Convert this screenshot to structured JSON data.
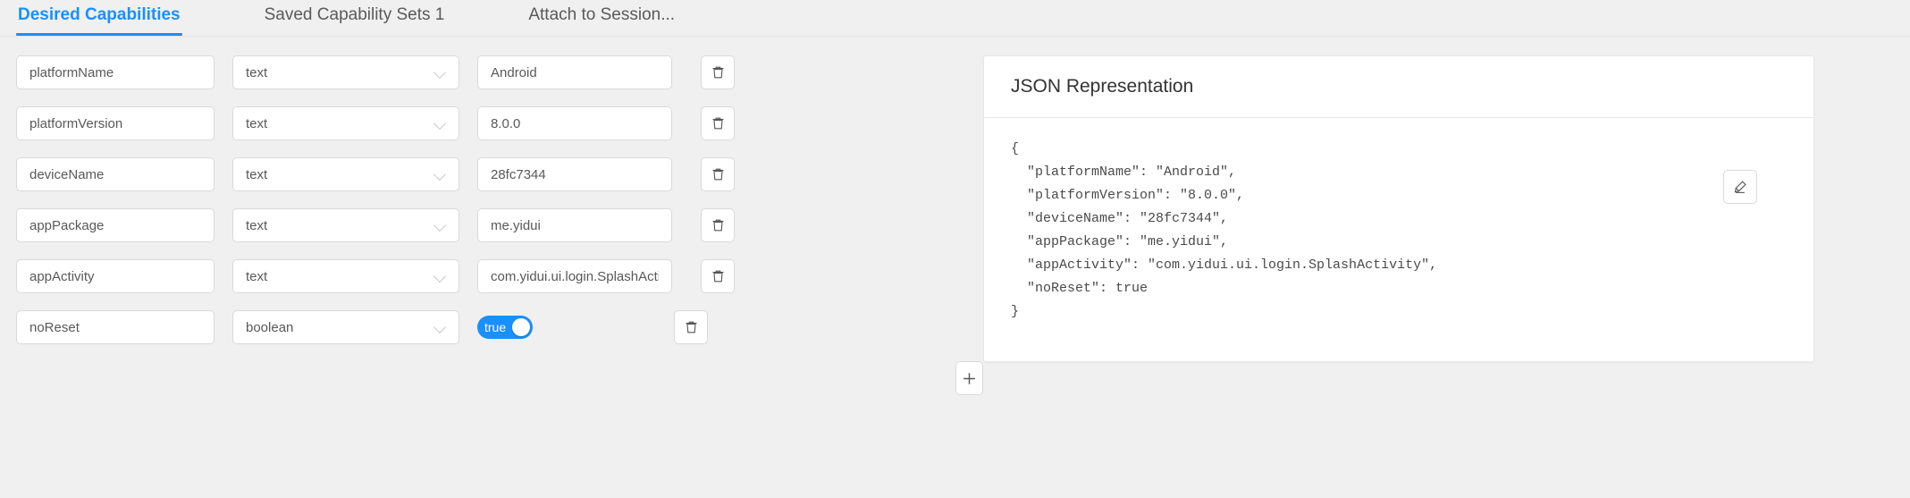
{
  "tabs": [
    {
      "label": "Desired Capabilities",
      "active": true
    },
    {
      "label": "Saved Capability Sets 1",
      "active": false
    },
    {
      "label": "Attach to Session...",
      "active": false
    }
  ],
  "capabilities": [
    {
      "name": "platformName",
      "type": "text",
      "value": "Android"
    },
    {
      "name": "platformVersion",
      "type": "text",
      "value": "8.0.0"
    },
    {
      "name": "deviceName",
      "type": "text",
      "value": "28fc7344"
    },
    {
      "name": "appPackage",
      "type": "text",
      "value": "me.yidui"
    },
    {
      "name": "appActivity",
      "type": "text",
      "value": "com.yidui.ui.login.SplashActivity"
    },
    {
      "name": "noReset",
      "type": "boolean",
      "value": "true",
      "boolean_on": true
    }
  ],
  "buttons": {
    "delete_icon": "trash-icon",
    "add_icon": "plus-icon",
    "edit_icon": "pencil-icon"
  },
  "json_panel": {
    "title": "JSON Representation",
    "code": "{\n  \"platformName\": \"Android\",\n  \"platformVersion\": \"8.0.0\",\n  \"deviceName\": \"28fc7344\",\n  \"appPackage\": \"me.yidui\",\n  \"appActivity\": \"com.yidui.ui.login.SplashActivity\",\n  \"noReset\": true\n}"
  },
  "colors": {
    "accent": "#1890ff",
    "page_bg": "#f0f0f0",
    "card_bg": "#ffffff",
    "border": "#d9d9d9",
    "text": "#595959"
  }
}
